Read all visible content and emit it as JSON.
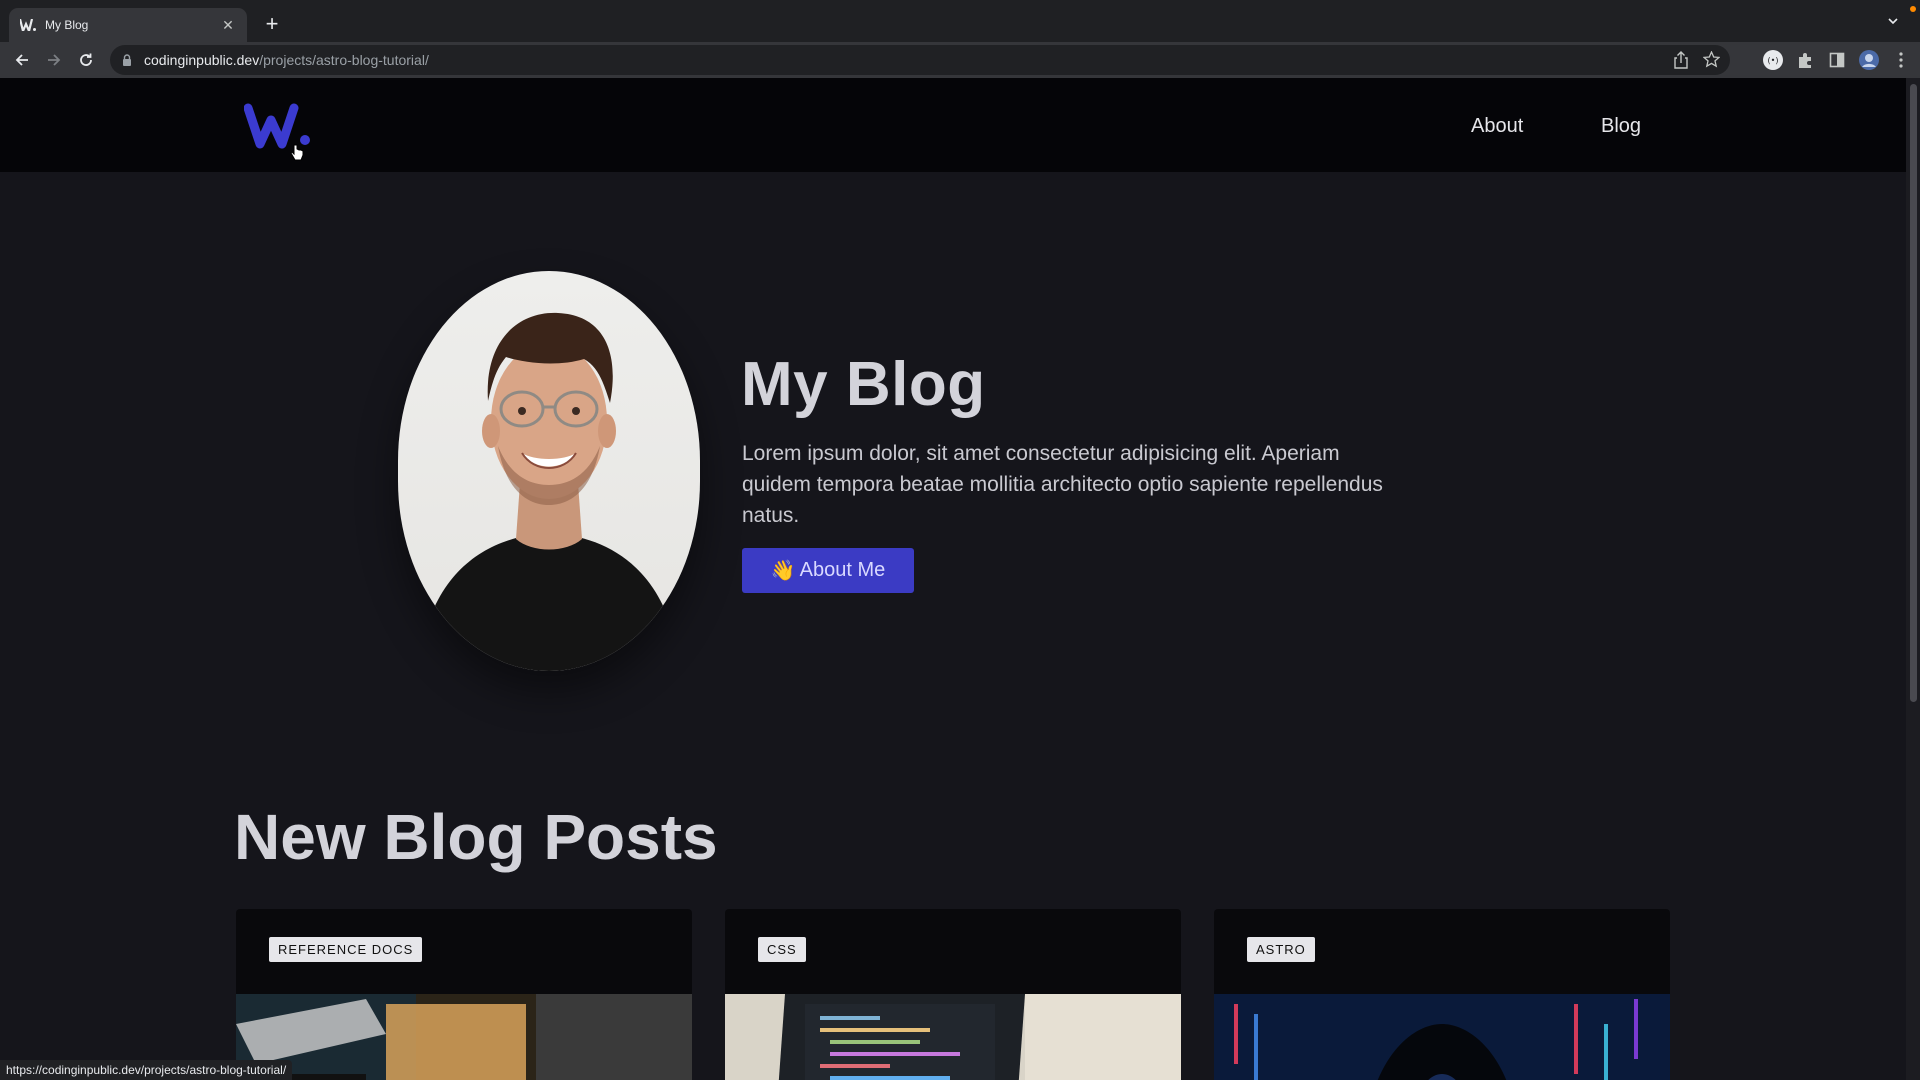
{
  "browser": {
    "tab_title": "My Blog",
    "url_host": "codinginpublic.dev",
    "url_path": "/projects/astro-blog-tutorial/",
    "status_url": "https://codinginpublic.dev/projects/astro-blog-tutorial/"
  },
  "site": {
    "logo_text": "W.",
    "nav": [
      {
        "label": "About"
      },
      {
        "label": "Blog"
      }
    ]
  },
  "hero": {
    "title": "My Blog",
    "text": "Lorem ipsum dolor, sit amet consectetur adipisicing elit. Aperiam quidem tempora beatae mollitia architecto optio sapiente repellendus natus.",
    "button_emoji": "👋",
    "button_label": "About Me"
  },
  "posts": {
    "title": "New Blog Posts",
    "cards": [
      {
        "tag": "REFERENCE DOCS"
      },
      {
        "tag": "CSS"
      },
      {
        "tag": "ASTRO"
      }
    ]
  },
  "colors": {
    "accent": "#3b3bc4",
    "page_bg": "#15151b",
    "header_bg": "#050508"
  }
}
